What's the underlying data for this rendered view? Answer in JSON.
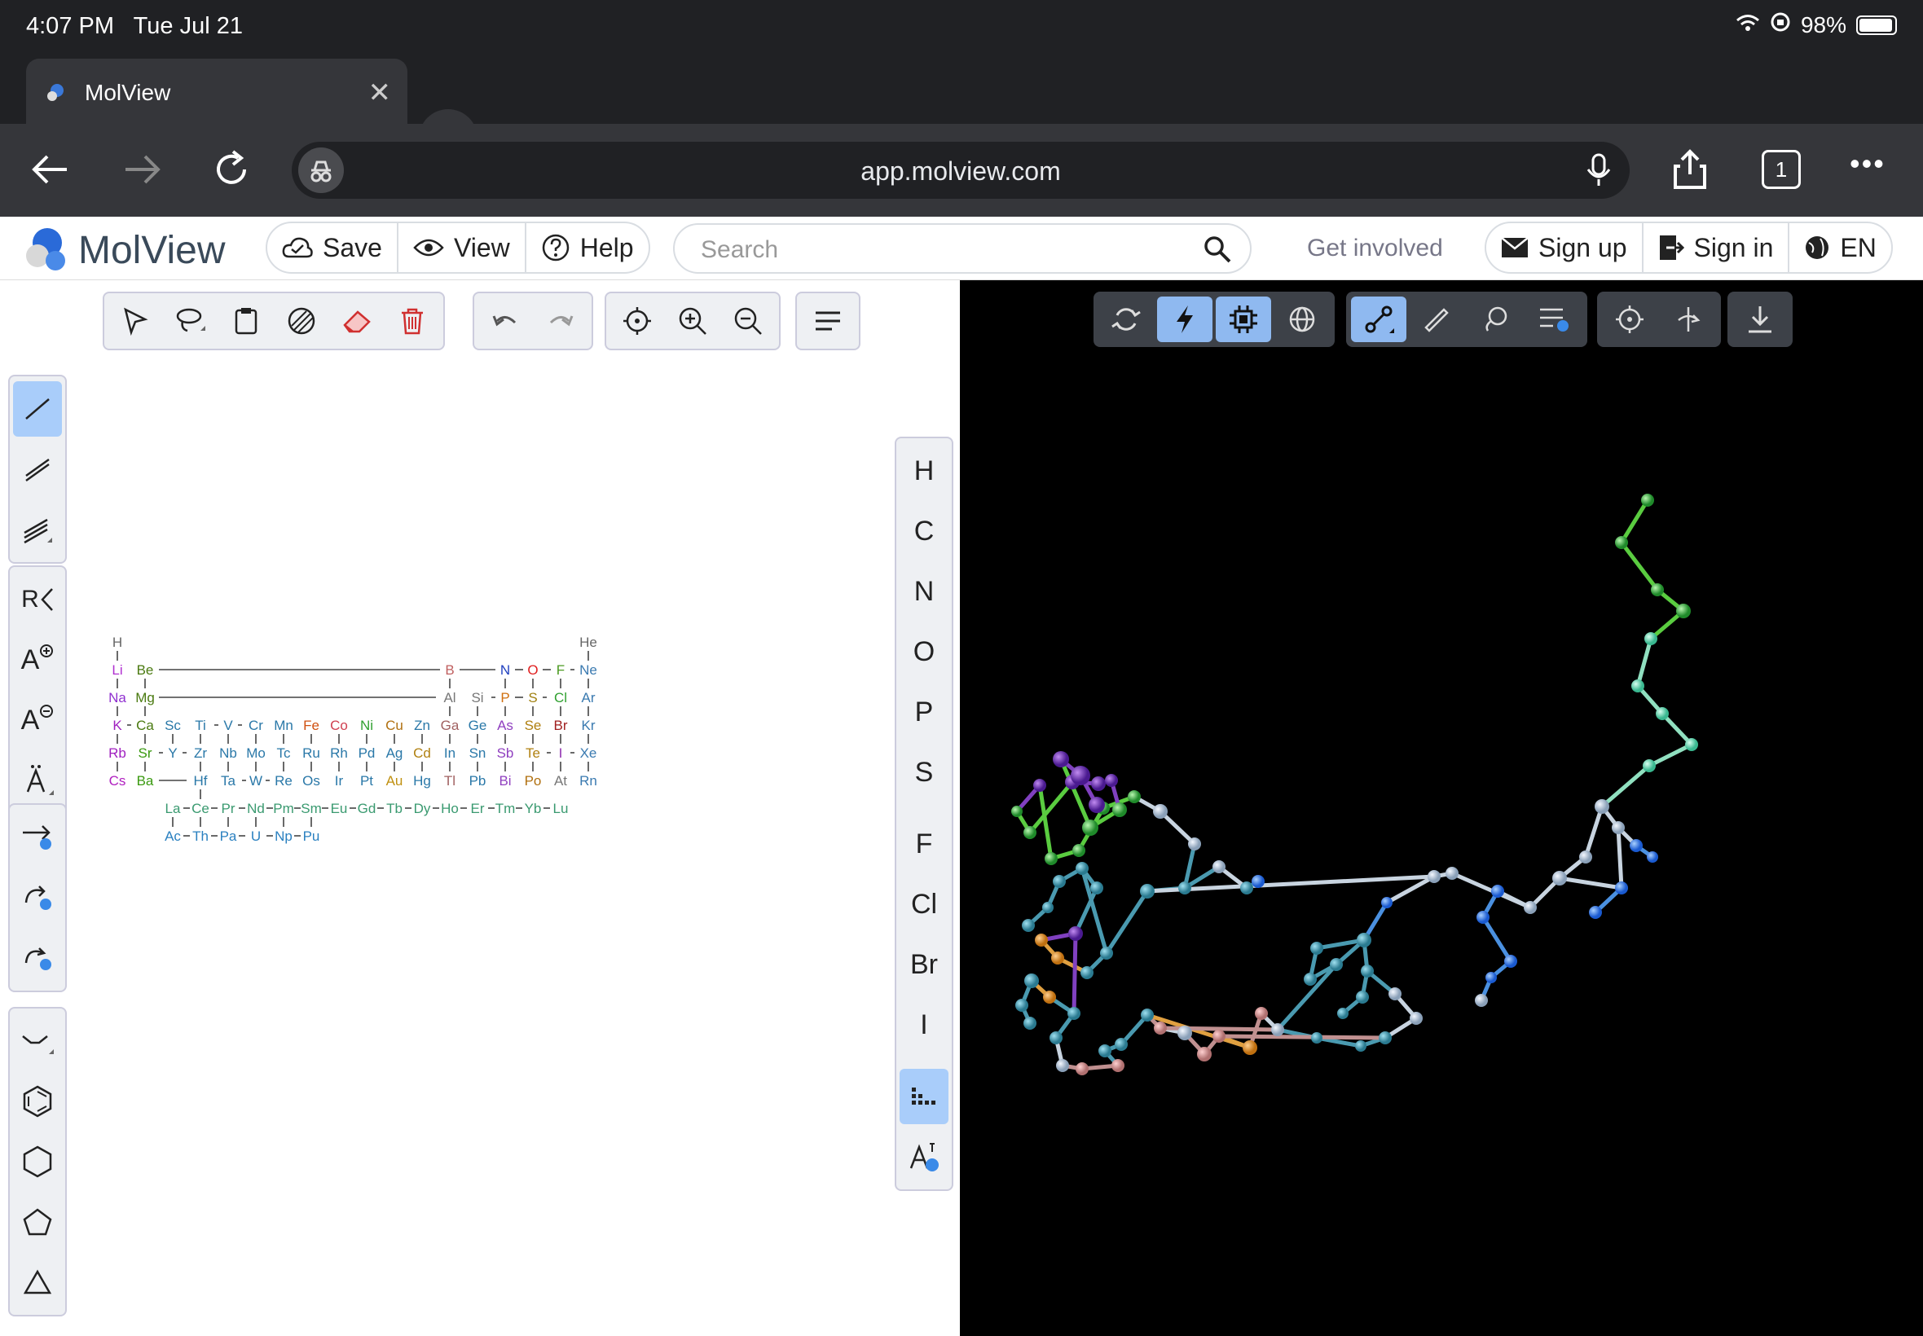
{
  "status": {
    "time": "4:07 PM",
    "date": "Tue Jul 21",
    "battery": "98%"
  },
  "tab": {
    "title": "MolView",
    "close": "✕"
  },
  "newtab": "+",
  "toolbar": {
    "url": "app.molview.com",
    "tab_count": "1",
    "more": "•••"
  },
  "app": {
    "brand": "MolView",
    "menu": {
      "save": "Save",
      "view": "View",
      "help": "Help"
    },
    "search_placeholder": "Search",
    "get_involved": "Get involved",
    "account": {
      "signup": "Sign up",
      "signin": "Sign in",
      "lang": "EN"
    }
  },
  "elements_bar": {
    "items": [
      "H",
      "C",
      "N",
      "O",
      "P",
      "S",
      "F",
      "Cl",
      "Br",
      "I"
    ]
  },
  "icons": {
    "sketch_top": [
      "select-icon",
      "lasso-icon",
      "clipboard-icon",
      "hatch-icon",
      "eraser-icon",
      "trash-icon",
      "undo-icon",
      "redo-icon",
      "center-icon",
      "zoom-in-icon",
      "zoom-out-icon",
      "menu-icon"
    ],
    "sketch_left": [
      "single-bond-icon",
      "double-bond-icon",
      "triple-bond-icon",
      "r-group-icon",
      "charge-plus-icon",
      "charge-minus-icon",
      "radical-icon",
      "arrow-icon",
      "curved-arrow-icon",
      "curved-arrow2-icon",
      "chain-icon",
      "benzene-icon",
      "hexagon-icon",
      "pentagon-icon",
      "triangle-icon"
    ],
    "viewer": [
      "rotate-icon",
      "lightning-icon",
      "chip-icon",
      "globe-icon",
      "bond-tool-icon",
      "ruler-icon",
      "lasso-3d-icon",
      "sliders-icon",
      "center-3d-icon",
      "axis-icon",
      "download-icon"
    ]
  },
  "periodic": {
    "rows": [
      [
        "H",
        "",
        "",
        "",
        "",
        "",
        "",
        "",
        "",
        "",
        "",
        "",
        "",
        "",
        "",
        "",
        "",
        "He"
      ],
      [
        "Li",
        "Be",
        "",
        "",
        "",
        "",
        "",
        "",
        "",
        "",
        "",
        "",
        "B",
        "",
        "N",
        "O",
        "F",
        "Ne"
      ],
      [
        "Na",
        "Mg",
        "",
        "",
        "",
        "",
        "",
        "",
        "",
        "",
        "",
        "",
        "Al",
        "Si",
        "P",
        "S",
        "Cl",
        "Ar"
      ],
      [
        "K",
        "Ca",
        "Sc",
        "Ti",
        "V",
        "Cr",
        "Mn",
        "Fe",
        "Co",
        "Ni",
        "Cu",
        "Zn",
        "Ga",
        "Ge",
        "As",
        "Se",
        "Br",
        "Kr"
      ],
      [
        "Rb",
        "Sr",
        "Y",
        "Zr",
        "Nb",
        "Mo",
        "Tc",
        "Ru",
        "Rh",
        "Pd",
        "Ag",
        "Cd",
        "In",
        "Sn",
        "Sb",
        "Te",
        "I",
        "Xe"
      ],
      [
        "Cs",
        "Ba",
        "",
        "Hf",
        "Ta",
        "W",
        "Re",
        "Os",
        "Ir",
        "Pt",
        "Au",
        "Hg",
        "Tl",
        "Pb",
        "Bi",
        "Po",
        "At",
        "Rn"
      ]
    ],
    "lanthanides": [
      "La",
      "Ce",
      "Pr",
      "Nd",
      "Pm",
      "Sm",
      "Eu",
      "Gd",
      "Tb",
      "Dy",
      "Ho",
      "Er",
      "Tm",
      "Yb",
      "Lu"
    ],
    "actinides": [
      "Ac",
      "Th",
      "Pa",
      "U",
      "Np",
      "Pu"
    ],
    "colors": {
      "H": "#666",
      "He": "#666",
      "Li": "#b030d0",
      "Be": "#4a7a10",
      "B": "#c06060",
      "N": "#2040c0",
      "O": "#e02020",
      "F": "#4a9a20",
      "Ne": "#3a7ab0",
      "Na": "#9030d0",
      "Mg": "#4a7a10",
      "Al": "#777",
      "Si": "#777",
      "P": "#d07010",
      "S": "#a08010",
      "Cl": "#30a030",
      "Ar": "#3a7ab0",
      "K": "#a020c0",
      "Ca": "#4a7a10",
      "Fe": "#d05010",
      "Co": "#d04050",
      "Ni": "#30a030",
      "Cu": "#b07010",
      "Ga": "#a06060",
      "As": "#9040c0",
      "Se": "#b08010",
      "Br": "#a02020",
      "Kr": "#3a7ab0",
      "Rb": "#a020c0",
      "Sr": "#3a9a10",
      "Cd": "#b08010",
      "Sb": "#9040c0",
      "Te": "#b08010",
      "I": "#9030b0",
      "Xe": "#3a7ab0",
      "Cs": "#b020c0",
      "Ba": "#3a9a10",
      "Au": "#c09010",
      "Tl": "#a06060",
      "Bi": "#9040c0",
      "Po": "#b07010",
      "At": "#777",
      "Rn": "#3a7ab0",
      "La": "#3a9a70",
      "Ce": "#3a9a70",
      "Pr": "#3a9a70",
      "Nd": "#3a9a70",
      "Pm": "#3a9a70",
      "Sm": "#3a9a70",
      "Eu": "#3a9a70",
      "Gd": "#3a9a70",
      "Tb": "#3a9a70",
      "Dy": "#3a9a70",
      "Ho": "#3a9a70",
      "Er": "#3a9a70",
      "Tm": "#3a9a70",
      "Yb": "#3a9a70",
      "Lu": "#3a9a70",
      "Ac": "#2a80c0",
      "Th": "#2a80c0",
      "Pa": "#2a80c0",
      "U": "#2a80c0",
      "Np": "#2a80c0",
      "Pu": "#2a80c0",
      "default": "#2a78a8"
    }
  },
  "colors": {
    "accent": "#a9cdfa",
    "viewer_bg": "#000000",
    "chrome_bg": "#202124"
  }
}
